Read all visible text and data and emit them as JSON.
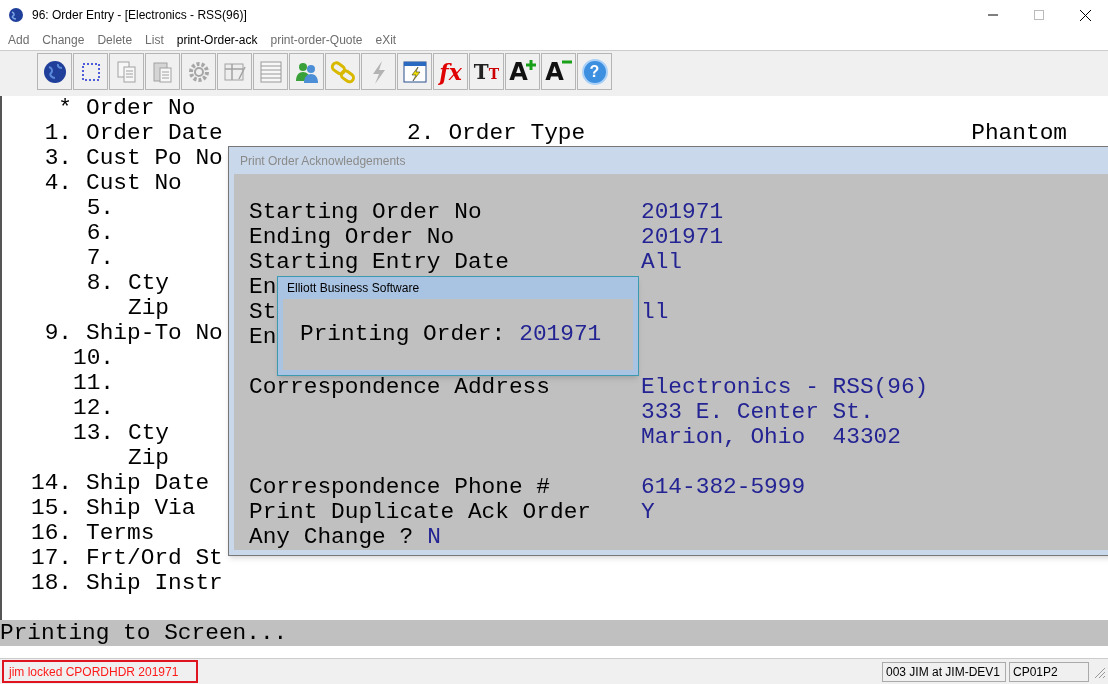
{
  "window": {
    "title": "96: Order Entry - [Electronics - RSS(96)]"
  },
  "menu": [
    {
      "label": "Add",
      "disabled": true
    },
    {
      "label": "Change",
      "disabled": true
    },
    {
      "label": "Delete",
      "disabled": true
    },
    {
      "label": "List",
      "disabled": true
    },
    {
      "label": "print-Order-ack",
      "disabled": false
    },
    {
      "label": "print-order-Quote",
      "disabled": true
    },
    {
      "label": "eXit",
      "disabled": true
    }
  ],
  "toolbar": [
    {
      "kind": "globe",
      "disabled": false
    },
    {
      "kind": "select",
      "disabled": false
    },
    {
      "kind": "copy",
      "disabled": true
    },
    {
      "kind": "paste",
      "disabled": true
    },
    {
      "kind": "gear",
      "disabled": true
    },
    {
      "kind": "form",
      "disabled": true
    },
    {
      "kind": "table",
      "disabled": true
    },
    {
      "kind": "users",
      "disabled": false
    },
    {
      "kind": "link",
      "disabled": false
    },
    {
      "kind": "bolt",
      "disabled": true
    },
    {
      "kind": "window",
      "disabled": false
    },
    {
      "kind": "text",
      "label": "fx",
      "disabled": false
    },
    {
      "kind": "text2",
      "label": "T",
      "label2": "T",
      "disabled": false
    },
    {
      "kind": "grow",
      "label": "A",
      "disabled": false
    },
    {
      "kind": "shrink",
      "label": "A",
      "disabled": false
    },
    {
      "kind": "help",
      "label": "?",
      "disabled": false
    }
  ],
  "screen": {
    "fields": [
      {
        "num": "*",
        "label": "Order No"
      },
      {
        "num": "1.",
        "label": "Order Date",
        "extra": {
          "num": "2.",
          "label": "Order Type",
          "value": "Phantom"
        }
      },
      {
        "num": "3.",
        "label": "Cust Po No"
      },
      {
        "num": "4.",
        "label": "Cust No",
        "children": [
          {
            "num": "5."
          },
          {
            "num": "6."
          },
          {
            "num": "7."
          },
          {
            "num": "8.",
            "label": "Cty"
          },
          {
            "label": "Zip"
          }
        ]
      },
      {
        "num": "9.",
        "label": "Ship-To No",
        "children": [
          {
            "num": "10."
          },
          {
            "num": "11."
          },
          {
            "num": "12."
          },
          {
            "num": "13.",
            "label": "Cty"
          },
          {
            "label": "Zip"
          }
        ]
      },
      {
        "num": "14.",
        "label": "Ship Date"
      },
      {
        "num": "15.",
        "label": "Ship Via"
      },
      {
        "num": "16.",
        "label": "Terms"
      },
      {
        "num": "17.",
        "label": "Frt/Ord St"
      },
      {
        "num": "18.",
        "label": "Ship Instr"
      }
    ],
    "message": "Printing to Screen..."
  },
  "dialog": {
    "title": "Print Order Acknowledgements",
    "rows": [
      {
        "kind": "field",
        "label": "Starting Order No",
        "value": "201971"
      },
      {
        "kind": "field",
        "label": "Ending Order No",
        "value": "201971"
      },
      {
        "kind": "field",
        "label": "Starting Entry Date",
        "value": "All"
      },
      {
        "kind": "field",
        "label": "En"
      },
      {
        "kind": "field",
        "label": "St",
        "value": "ll"
      },
      {
        "kind": "field",
        "label": "En"
      },
      {
        "kind": "spacer"
      },
      {
        "kind": "field",
        "label": "Correspondence Address",
        "value": "Electronics - RSS(96)"
      },
      {
        "kind": "field",
        "value": "333 E. Center St."
      },
      {
        "kind": "field",
        "value": "Marion, Ohio  43302"
      },
      {
        "kind": "spacer"
      },
      {
        "kind": "field",
        "label": "Correspondence Phone #",
        "value": "614-382-5999"
      },
      {
        "kind": "field",
        "label": "Print Duplicate Ack Order",
        "value": "Y"
      },
      {
        "kind": "prompt",
        "label": "Any Change ?",
        "value": "N"
      }
    ]
  },
  "message_box": {
    "title": "Elliott Business Software",
    "label": "Printing Order:",
    "value": "201971"
  },
  "status_bar": {
    "lock_message": "jim locked CPORDHDR 201971",
    "user": "003 JIM at JIM-DEV1",
    "program": "CP01P2"
  }
}
